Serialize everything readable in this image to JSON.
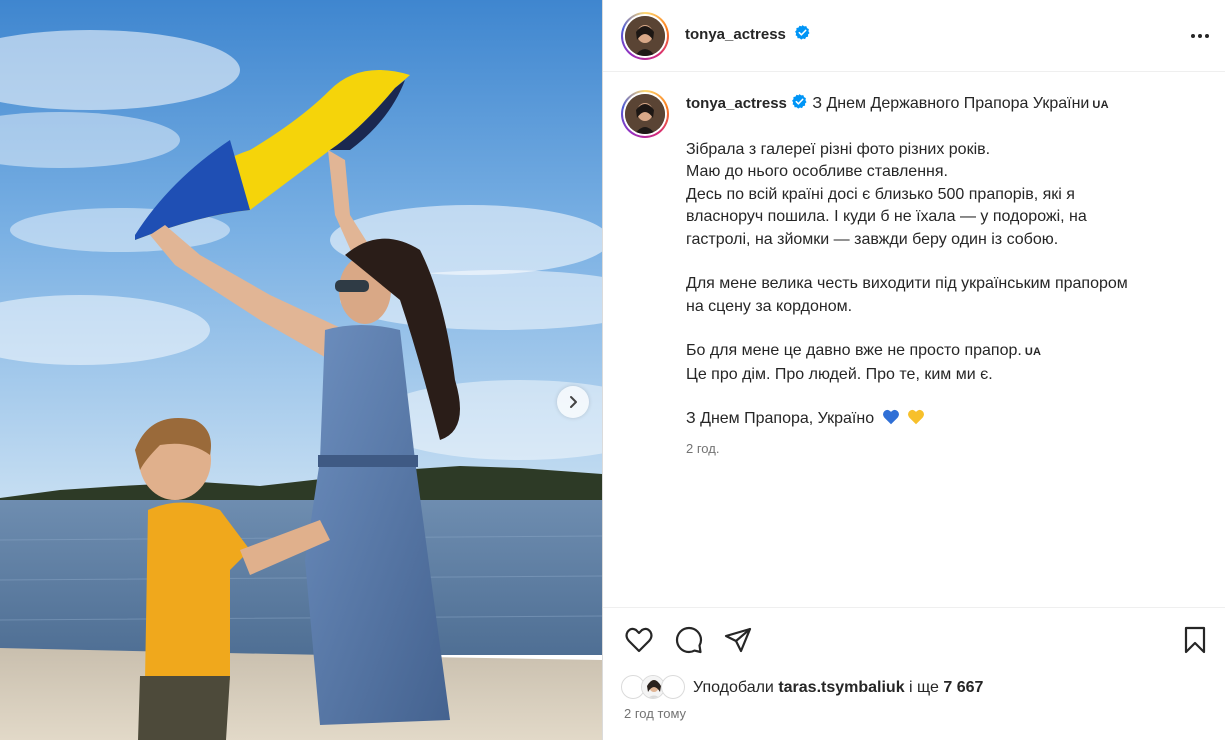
{
  "post": {
    "author": "tonya_actress",
    "caption_title": "З Днем Державного Прапора України",
    "caption_title_tag": "UA",
    "caption_paragraphs": [
      [
        "Зібрала з галереї різні фото різних років.",
        "Маю до нього особливе ставлення.",
        "Десь по всій країні досі є близько 500 прапорів, які я",
        "власноруч пошила. І куди б не їхала — у подорожі, на",
        "гастролі, на зйомки — завжди беру один із собою."
      ],
      [
        "Для мене велика честь виходити під українським прапором",
        "на сцену за кордоном."
      ]
    ],
    "line_flag": "Бо для мене це давно вже не просто прапор.",
    "line_flag_tag": "UA",
    "line_home": "Це про дім. Про людей. Про те, ким ми є.",
    "closing": "З Днем Прапора, Україно",
    "caption_time": "2 год.",
    "likes_prefix": "Уподобали",
    "likes_user": "taras.tsymbaliuk",
    "likes_joiner": "і ще",
    "likes_count": "7 667",
    "time_ago": "2 год тому"
  },
  "icons": {
    "verified": "verified-badge-icon",
    "more": "more-options-icon",
    "like": "heart-icon",
    "comment": "comment-icon",
    "share": "share-icon",
    "save": "bookmark-icon",
    "next": "chevron-right-icon"
  },
  "colors": {
    "verified": "#0095f6",
    "text": "#262626",
    "muted": "#737373",
    "flag_blue": "#1f4fb4",
    "flag_yellow": "#f5d40a"
  }
}
